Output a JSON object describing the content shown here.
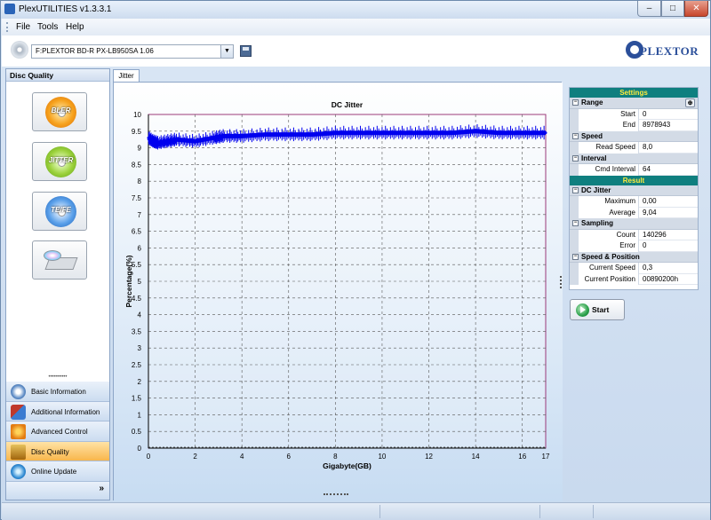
{
  "window": {
    "title": "PlexUTILITIES v1.3.3.1",
    "min": "–",
    "max": "□",
    "close": "✕"
  },
  "menu": {
    "file": "File",
    "tools": "Tools",
    "help": "Help"
  },
  "toolbar": {
    "drive": "F:PLEXTOR BD-R  PX-LB950SA 1.06",
    "logo": "PLEXTOR"
  },
  "left": {
    "header": "Disc Quality",
    "buttons": {
      "bler": "BLER",
      "jitter": "JITTER",
      "tefe": "TE/FE"
    },
    "nav": [
      {
        "label": "Basic Information",
        "icon": "info-icon"
      },
      {
        "label": "Additional Information",
        "icon": "additional-info-icon"
      },
      {
        "label": "Advanced Control",
        "icon": "advanced-control-icon"
      },
      {
        "label": "Disc Quality",
        "icon": "disc-quality-icon",
        "active": true
      },
      {
        "label": "Online Update",
        "icon": "online-update-icon"
      }
    ],
    "more": "»"
  },
  "tab": {
    "label": "Jitter"
  },
  "chart_data": {
    "type": "line",
    "title": "DC Jitter",
    "xlabel": "Gigabyte(GB)",
    "ylabel": "Percentage(%)",
    "xlim": [
      0,
      17
    ],
    "ylim": [
      0,
      10
    ],
    "xticks": [
      0,
      2,
      4,
      6,
      8,
      10,
      12,
      14,
      16,
      17
    ],
    "yticks": [
      0,
      0.5,
      1,
      1.5,
      2,
      2.5,
      3,
      3.5,
      4,
      4.5,
      5,
      5.5,
      6,
      6.5,
      7,
      7.5,
      8,
      8.5,
      9,
      9.5,
      10
    ],
    "grid": true,
    "series": [
      {
        "color": "#0000ee",
        "x": [
          0,
          0.2,
          0.4,
          0.8,
          1.2,
          2.0,
          2.8,
          3.2,
          4.0,
          5.0,
          6.0,
          7.0,
          8.0,
          9.0,
          10.0,
          11.0,
          12.0,
          13.0,
          14.0,
          15.0,
          16.0,
          17.0
        ],
        "y": [
          9.3,
          9.2,
          9.15,
          9.2,
          9.25,
          9.2,
          9.3,
          9.35,
          9.35,
          9.4,
          9.4,
          9.4,
          9.45,
          9.45,
          9.45,
          9.45,
          9.45,
          9.45,
          9.5,
          9.45,
          9.45,
          9.45
        ]
      }
    ]
  },
  "settings": {
    "header": "Settings",
    "range": {
      "title": "Range",
      "start_label": "Start",
      "start": "0",
      "end_label": "End",
      "end": "8978943"
    },
    "speed": {
      "title": "Speed",
      "read_label": "Read Speed",
      "read": "8,0"
    },
    "interval": {
      "title": "Interval",
      "cmd_label": "Cmd Interval",
      "cmd": "64"
    },
    "result_header": "Result",
    "dcjitter": {
      "title": "DC Jitter",
      "max_label": "Maximum",
      "max": "0,00",
      "avg_label": "Average",
      "avg": "9,04"
    },
    "sampling": {
      "title": "Sampling",
      "count_label": "Count",
      "count": "140296",
      "error_label": "Error",
      "error": "0"
    },
    "sp": {
      "title": "Speed & Position",
      "cs_label": "Current Speed",
      "cs": "0,3",
      "cp_label": "Current Position",
      "cp": "00890200h"
    }
  },
  "start_button": "Start"
}
